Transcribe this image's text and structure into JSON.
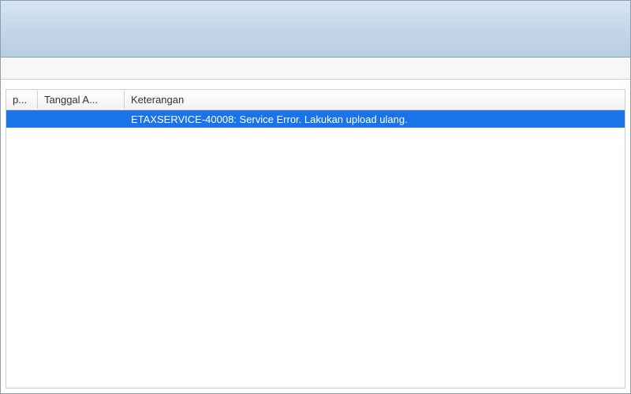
{
  "table": {
    "columns": {
      "c0": "p...",
      "c1": "Tanggal A...",
      "c2": "Keterangan"
    },
    "rows": [
      {
        "c0": "",
        "c1": "",
        "c2": "ETAXSERVICE-40008: Service Error. Lakukan upload ulang.",
        "selected": true
      }
    ]
  },
  "colors": {
    "selection": "#1a74e8",
    "headerGradientTop": "#d8e6f3",
    "headerGradientBottom": "#b8cde0"
  }
}
